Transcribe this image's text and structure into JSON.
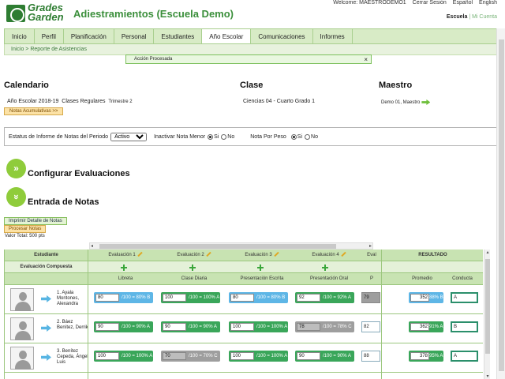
{
  "brand": {
    "logo_line1": "Grades",
    "logo_line2": "Garden",
    "app_title": "Adiestramientos (Escuela Demo)"
  },
  "userbar": {
    "welcome": "Welcome: MAESTRODEMO1",
    "logout": "Cerrar Sesión",
    "lang1": "Español",
    "lang2": "English"
  },
  "schoolbar": {
    "school": "Escuela",
    "separator": "|",
    "account": "Mi Cuenta"
  },
  "nav": {
    "items": [
      "Inicio",
      "Perfil",
      "Planificación",
      "Personal",
      "Estudiantes",
      "Año Escolar",
      "Comunicaciones",
      "Informes"
    ],
    "active": "Año Escolar"
  },
  "breadcrumb": {
    "home": "Inicio",
    "sep": ">",
    "current": "Reporte de Asistencias"
  },
  "alert": {
    "text": "Acción Procesada",
    "close": "×"
  },
  "calendar": {
    "heading": "Calendario",
    "year": "Año Escolar 2018-19",
    "class_type": "Clases Regulares",
    "term": "Trimestre 2",
    "button": "Notas Acumulativas >>"
  },
  "class": {
    "heading": "Clase",
    "value": "Ciencias 04 - Cuarto Grado 1"
  },
  "teacher": {
    "heading": "Maestro",
    "value": "Demo 01, Maestro"
  },
  "filters": {
    "status_label": "Estatus de Informe de Notas del Periodo",
    "status_value": "Activo",
    "inactivate_label": "Inactivar Nota Menor",
    "inactivate_yes": "Si",
    "inactivate_no": "No",
    "weight_label": "Nota Por Peso",
    "weight_yes": "Si",
    "weight_no": "No"
  },
  "sections": {
    "configure": "Configurar Evaluaciones",
    "entry": "Entrada de Notas"
  },
  "actions": {
    "print": "Imprimir Detalle de Notas",
    "process": "Procesar Notas",
    "total": "Valor Total: 500 pts"
  },
  "grid": {
    "header1": {
      "student": "Estudiante",
      "eval1": "Evaluación 1",
      "eval2": "Evaluación 2",
      "eval3": "Evaluación 3",
      "eval4": "Evaluación 4",
      "eval5": "Eval",
      "result": "RESULTADO"
    },
    "header2": {
      "composite": "Evaluación Compuesta"
    },
    "header3": {
      "c1": "Libreta",
      "c2": "Clase Diaria",
      "c3": "Presentación Escrita",
      "c4": "Presentación Oral",
      "c5": "P",
      "avg": "Promedio",
      "conduct": "Conducta"
    },
    "rows": [
      {
        "name": "1. Ayala Montones, Alexandra",
        "g1": {
          "val": "80",
          "txt": "/100 = 80% B"
        },
        "g2": {
          "val": "100",
          "txt": "/100 = 100% A"
        },
        "g3": {
          "val": "80",
          "txt": "/100 = 80% B"
        },
        "g4": {
          "val": "92",
          "txt": "/100 = 92% A"
        },
        "g5": "79",
        "avg_val": "352",
        "avg_txt": "88% B",
        "conduct": "A"
      },
      {
        "name": "2. Báez Benítez, Derrik",
        "g1": {
          "val": "90",
          "txt": "/100 = 90% A"
        },
        "g2": {
          "val": "90",
          "txt": "/100 = 90% A"
        },
        "g3": {
          "val": "100",
          "txt": "/100 = 100% A"
        },
        "g4": {
          "val": "78",
          "txt": "/100 = 78% C"
        },
        "g5": "82",
        "avg_val": "362",
        "avg_txt": "91% A",
        "conduct": "B"
      },
      {
        "name": "3. Benítez Cepeda, Ángel Luis",
        "g1": {
          "val": "100",
          "txt": "/100 = 100% A"
        },
        "g2": {
          "val": "70",
          "txt": "/100 = 70% C"
        },
        "g3": {
          "val": "100",
          "txt": "/100 = 100% A"
        },
        "g4": {
          "val": "90",
          "txt": "/100 = 90% A"
        },
        "g5": "88",
        "avg_val": "378",
        "avg_txt": "95% A",
        "conduct": "A"
      }
    ]
  },
  "colors": {
    "brand_green": "#2e7d32",
    "nav_bg": "#d8ebc6",
    "grade_green": "#3aa65a",
    "grade_blue": "#5eb6e6",
    "grade_gray": "#9e9e9e"
  }
}
